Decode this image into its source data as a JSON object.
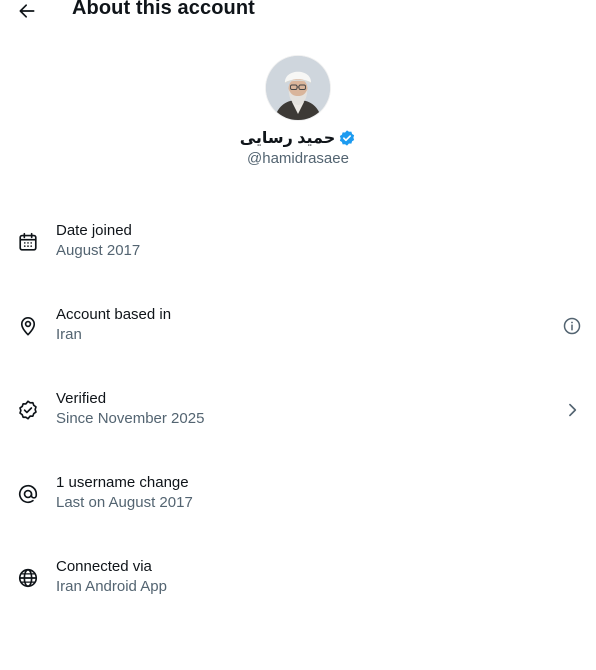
{
  "header": {
    "title": "About this account"
  },
  "profile": {
    "display_name": "حمید رسایی",
    "handle": "@hamidrasaee",
    "verified_color": "#1d9bf0"
  },
  "details": [
    {
      "icon": "calendar-icon",
      "label": "Date joined",
      "value": "August 2017"
    },
    {
      "icon": "location-pin-icon",
      "label": "Account based in",
      "value": "Iran",
      "trailing_icon": "info-icon"
    },
    {
      "icon": "verified-badge-icon",
      "label": "Verified",
      "value": "Since November 2025",
      "trailing_icon": "chevron-right-icon"
    },
    {
      "icon": "at-sign-icon",
      "label": "1 username change",
      "value": "Last on August 2017"
    },
    {
      "icon": "globe-icon",
      "label": "Connected via",
      "value": "Iran Android App"
    }
  ]
}
